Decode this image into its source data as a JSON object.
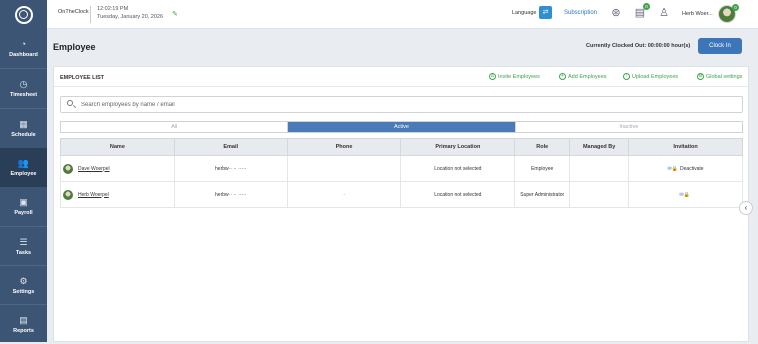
{
  "header": {
    "app_name": "OnTheClock",
    "time": "12:02:19 PM",
    "date": "Tuesday, January 20, 2026",
    "language_label": "Language",
    "subscription_label": "Subscription",
    "notes_badge": "0",
    "profile_badge": "0",
    "user_name": "Herb Woer..."
  },
  "sidebar": {
    "items": [
      {
        "label": "Dashboard",
        "icon": "gauge-icon"
      },
      {
        "label": "Timesheet",
        "icon": "clock-icon"
      },
      {
        "label": "Schedule",
        "icon": "calendar-icon"
      },
      {
        "label": "Employee",
        "icon": "people-icon"
      },
      {
        "label": "Payroll",
        "icon": "briefcase-icon"
      },
      {
        "label": "Tasks",
        "icon": "tasks-icon"
      },
      {
        "label": "Settings",
        "icon": "gear-icon"
      },
      {
        "label": "Reports",
        "icon": "report-icon"
      }
    ]
  },
  "page": {
    "title": "Employee",
    "clock_status": "Currently Clocked Out: 00:00:00 hour(s)",
    "clock_in_label": "Clock In"
  },
  "panel": {
    "title": "EMPLOYEE LIST",
    "actions": {
      "invite": "Invite Employees",
      "add": "Add Employees",
      "upload": "Upload Employees",
      "global": "Global settings"
    },
    "search_placeholder": "Search employees by name / email",
    "tabs": [
      "All",
      "Active",
      "Inactive"
    ],
    "columns": [
      "Name",
      "Email",
      "Phone",
      "Primary Location",
      "Role",
      "Managed By",
      "Invitation"
    ],
    "rows": [
      {
        "name": "Dave Woerpel",
        "email": "herbw·· ·· ·····",
        "phone": "",
        "location": "Location not selected",
        "role": "Employee",
        "managed_by": "",
        "invitation": "Deactivate"
      },
      {
        "name": "Herb Woerpel",
        "email": "herbw·· ·· ·····",
        "phone": "·",
        "location": "Location not selected",
        "role": "Super Administrator",
        "managed_by": "",
        "invitation": ""
      }
    ]
  },
  "colors": {
    "sidebar": "#3d5575",
    "accent": "#3d76b8",
    "green": "#3ea34a"
  }
}
